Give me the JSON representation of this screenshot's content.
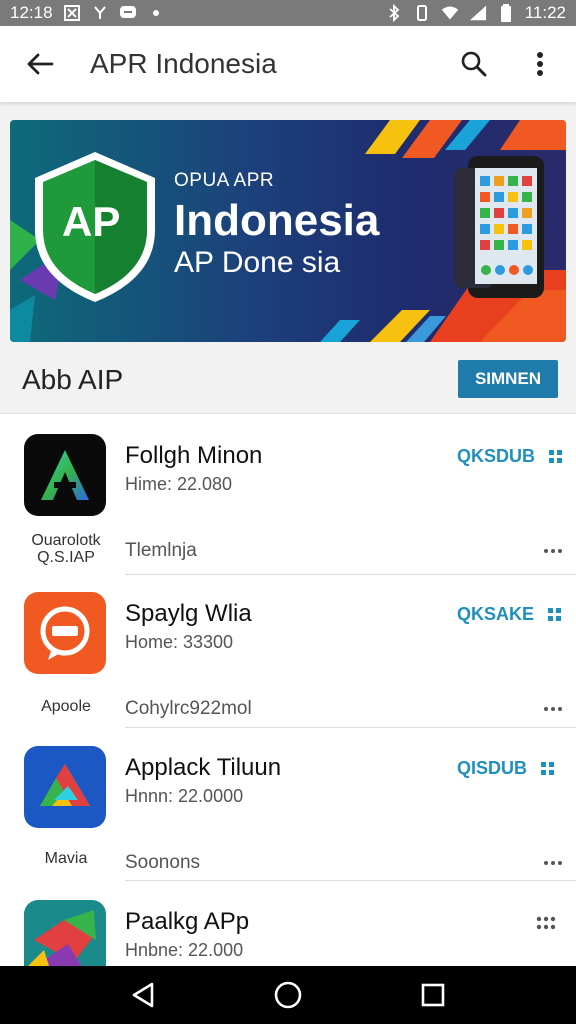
{
  "status_bar": {
    "time_left": "12:18",
    "time_right": "11:22",
    "icons": [
      "close-box-icon",
      "wrench-icon",
      "chat-icon",
      "dot-icon",
      "bluetooth-icon",
      "vibrate-icon",
      "wifi-icon",
      "signal-icon",
      "battery-icon"
    ]
  },
  "app_bar": {
    "title": "APR Indonesia",
    "icons": [
      "back-arrow-icon",
      "search-icon",
      "more-vert-icon"
    ]
  },
  "banner": {
    "kicker": "OPUA APR",
    "title": "Indonesia",
    "subtitle": "AP Done sia",
    "shield_text": "AP",
    "colors": {
      "shield": "#1e9a3a",
      "bg_start": "#0e6a7a",
      "bg_end": "#2a2a6a",
      "stripe_orange": "#f05a22",
      "stripe_yellow": "#f6c20f"
    }
  },
  "section": {
    "title": "Abb AIP",
    "button_label": "SIMNEN",
    "accent": "#1f7bab"
  },
  "apps": [
    {
      "title": "Follgh Minon",
      "subtitle": "Hime: 22.080",
      "note": "Tlemlnja",
      "caption": "Ouarolotk\nQ.S.IAP",
      "action": "QKSDUB",
      "icon_name": "letter-a-app-icon"
    },
    {
      "title": "Spaylg Wlia",
      "subtitle": "Home: 33300",
      "note": "Cohylrc922mol",
      "caption": "Apoole",
      "action": "QKSAKE",
      "icon_name": "chat-bubble-app-icon"
    },
    {
      "title": "Applack Tiluun",
      "subtitle": "Hnnn: 22.0000",
      "note": "Soonons",
      "caption": "Mavia",
      "action": "QISDUB",
      "icon_name": "triangle-app-icon"
    },
    {
      "title": "Paalkg APp",
      "subtitle": "Hnbne: 22.000",
      "note": "",
      "caption": "",
      "action": "",
      "icon_name": "colorful-shape-app-icon"
    }
  ],
  "nav_bar": {
    "icons": [
      "nav-back-icon",
      "nav-home-icon",
      "nav-recents-icon"
    ]
  }
}
